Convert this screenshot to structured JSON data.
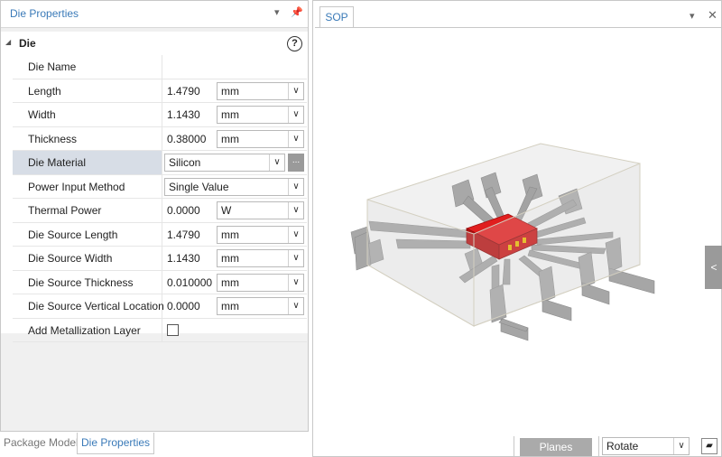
{
  "left_panel": {
    "title": "Die Properties",
    "group_label": "Die",
    "help_glyph": "?",
    "rows": [
      {
        "name": "Die Name",
        "value": "",
        "unit": ""
      },
      {
        "name": "Length",
        "value": "1.4790",
        "unit": "mm"
      },
      {
        "name": "Width",
        "value": "1.1430",
        "unit": "mm"
      },
      {
        "name": "Thickness",
        "value": "0.38000",
        "unit": "mm"
      },
      {
        "name": "Die Material",
        "value": "Silicon",
        "unit": ""
      },
      {
        "name": "Power Input Method",
        "value": "Single Value",
        "unit": ""
      },
      {
        "name": "Thermal Power",
        "value": "0.0000",
        "unit": "W"
      },
      {
        "name": "Die Source Length",
        "value": "1.4790",
        "unit": "mm"
      },
      {
        "name": "Die Source Width",
        "value": "1.1430",
        "unit": "mm"
      },
      {
        "name": "Die Source Thickness",
        "value": "0.010000",
        "unit": "mm"
      },
      {
        "name": "Die Source Vertical Location",
        "value": "0.0000",
        "unit": "mm"
      },
      {
        "name": "Add Metallization Layer",
        "value": "",
        "unit": ""
      }
    ],
    "ellipsis": "...",
    "metallization_checked": false
  },
  "bottom_tabs": [
    "Package Model",
    "Die Properties"
  ],
  "viewer": {
    "tab": "SOP",
    "side_handle": "<",
    "planes_label": "Planes",
    "mode_value": "Rotate"
  },
  "icons": {
    "dropdown": "chevron-down-icon",
    "pin": "pin-icon",
    "close": "close-icon",
    "help": "help-icon",
    "collapse": "collapse-triangle-icon",
    "view_cube": "view-cube-icon"
  },
  "colors": {
    "accent": "#3a7ab8",
    "selected_row": "#d7dde6",
    "die": "#d01515",
    "leads": "#a6a6a6",
    "button_gray": "#aaaaaa"
  }
}
